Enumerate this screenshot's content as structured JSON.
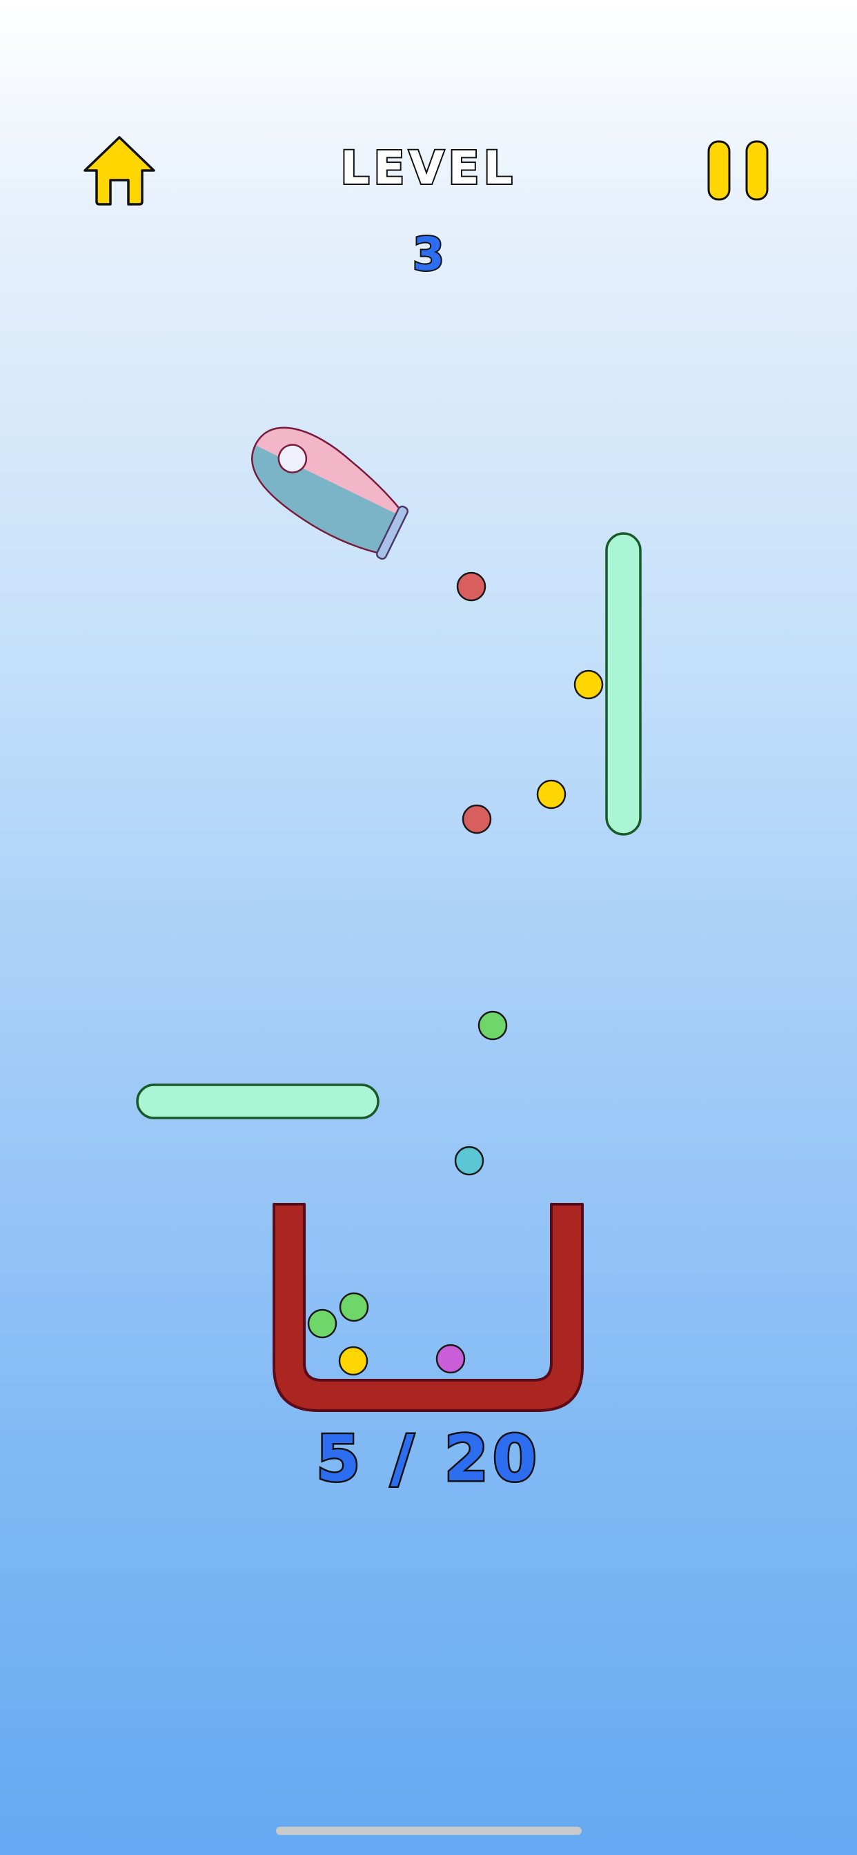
{
  "hud": {
    "level_label": "LEVEL",
    "level_number": "3",
    "home_icon": "home-icon",
    "pause_icon": "pause-icon"
  },
  "score": {
    "text": "5 / 20",
    "collected": 5,
    "total": 20
  },
  "colors": {
    "yellow": "#ffd600",
    "red": "#d95f5f",
    "green": "#6fd66a",
    "cyan": "#5bc6d4",
    "purple": "#c95ed8",
    "mint": "#aaf5d4",
    "cup": "#ab2620",
    "cannon_pink": "#f2b6c8",
    "cannon_blue": "#7ab4c6"
  }
}
